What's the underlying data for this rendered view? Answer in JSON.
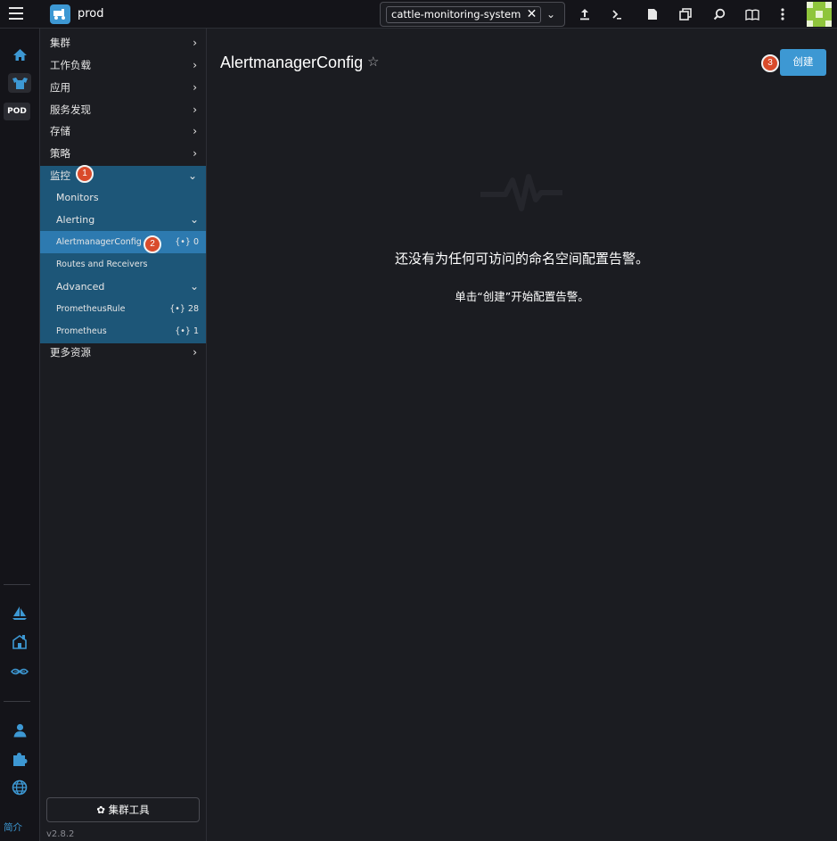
{
  "topbar": {
    "cluster_name": "prod",
    "namespace_filter": "cattle-monitoring-system",
    "icons": [
      "import-yaml-icon",
      "kubectl-shell-icon",
      "kubeconfig-download-icon",
      "copy-kubeconfig-icon",
      "search-icon",
      "docs-icon",
      "more-icon"
    ]
  },
  "rail": {
    "pod_label": "POD",
    "about_label": "简介"
  },
  "nav": {
    "items": [
      {
        "label": "集群"
      },
      {
        "label": "工作负载"
      },
      {
        "label": "应用"
      },
      {
        "label": "服务发现"
      },
      {
        "label": "存储"
      },
      {
        "label": "策略"
      },
      {
        "label": "监控"
      },
      {
        "label": "更多资源"
      }
    ],
    "monitoring": {
      "monitors": "Monitors",
      "alerting": "Alerting",
      "alertmanager_config": {
        "label": "AlertmanagerConfig",
        "count": "0"
      },
      "routes_receivers": "Routes and Receivers",
      "advanced": "Advanced",
      "prometheus_rule": {
        "label": "PrometheusRule",
        "count": "28"
      },
      "prometheus": {
        "label": "Prometheus",
        "count": "1"
      }
    },
    "cluster_tools": "集群工具",
    "version": "v2.8.2"
  },
  "annotations": [
    "1",
    "2",
    "3"
  ],
  "main": {
    "title": "AlertmanagerConfig",
    "create_button": "创建",
    "empty_title": "还没有为任何可访问的命名空间配置告警。",
    "empty_subtitle": "单击“创建”开始配置告警。"
  },
  "colors": {
    "accent": "#3d98d3",
    "nav_group_bg": "#1d5678",
    "nav_selected": "#2d7ab0",
    "annotation_badge": "#d94b2b",
    "background": "#1b1c21"
  }
}
